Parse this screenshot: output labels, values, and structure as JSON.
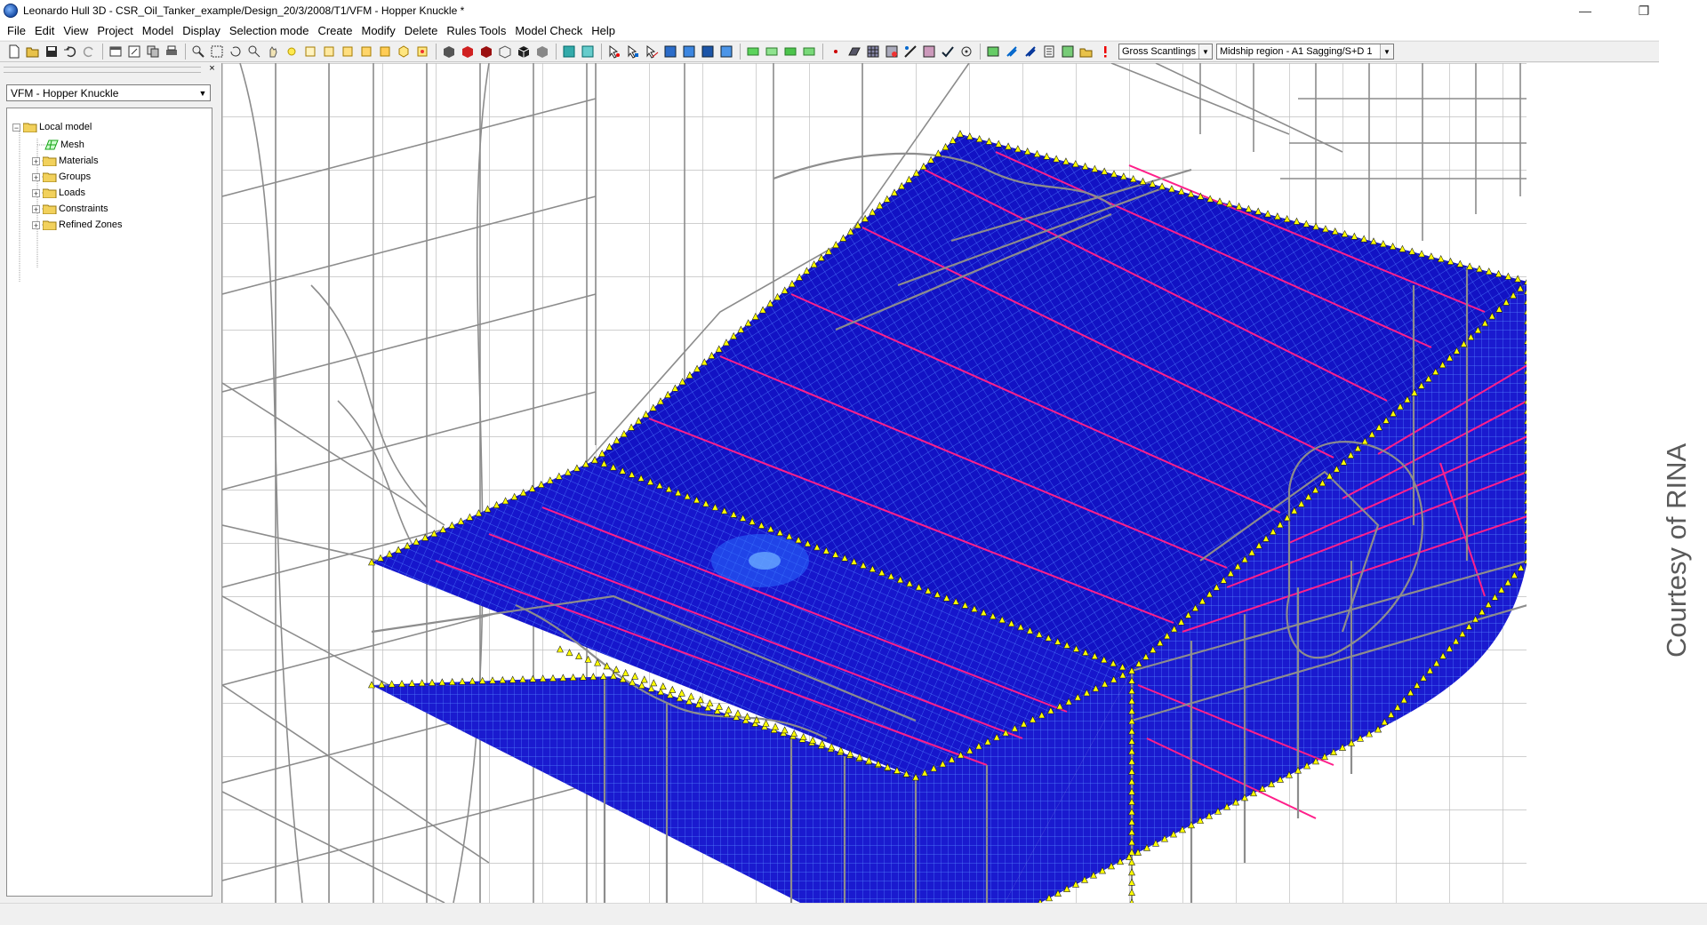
{
  "window": {
    "title": "Leonardo Hull 3D - CSR_Oil_Tanker_example/Design_20/3/2008/T1/VFM - Hopper Knuckle *",
    "minimize_glyph": "—",
    "maximize_glyph": "❐",
    "close_glyph": "✕"
  },
  "menu": {
    "items": [
      "File",
      "Edit",
      "View",
      "Project",
      "Model",
      "Display",
      "Selection mode",
      "Create",
      "Modify",
      "Delete",
      "Rules Tools",
      "Model Check",
      "Help"
    ]
  },
  "toolbar": {
    "scantlings_select": "Gross Scantlings",
    "loadcase_select": "Midship region - A1 Sagging/S+D 1"
  },
  "left_panel": {
    "close_glyph": "×",
    "model_select": "VFM - Hopper Knuckle",
    "tree": {
      "root": "Local model",
      "items": [
        "Mesh",
        "Materials",
        "Groups",
        "Loads",
        "Constraints",
        "Refined Zones"
      ]
    }
  },
  "viewport": {
    "credit": "Courtesy of RINA"
  },
  "colors": {
    "mesh_fill": "#1515c8",
    "mesh_line": "#4a7bff",
    "stiffener": "#ff1f8a",
    "wireframe": "#8a8a8a",
    "constraint": "#ffff00"
  },
  "icons": {
    "app": "leonardo-logo-icon",
    "mesh": "mesh-icon",
    "folder": "folder-icon"
  }
}
